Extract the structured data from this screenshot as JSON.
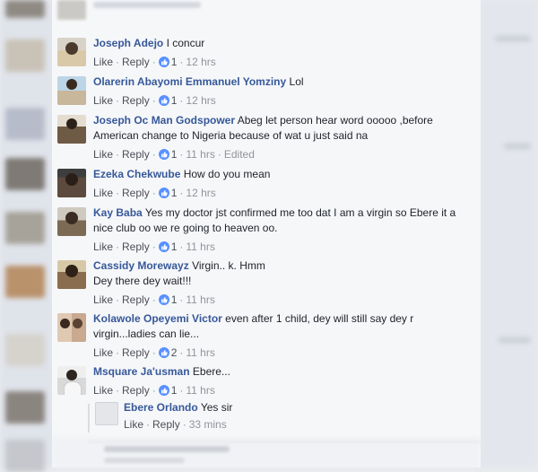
{
  "actions": {
    "like": "Like",
    "reply": "Reply"
  },
  "comments": [
    {
      "name": "Joseph Adejo",
      "text": "I concur",
      "likes": "1",
      "time": "12 hrs",
      "edited": ""
    },
    {
      "name": "Olarerin Abayomi Emmanuel Yomziny",
      "text": "Lol",
      "likes": "1",
      "time": "12 hrs",
      "edited": ""
    },
    {
      "name": "Joseph Oc Man Godspower",
      "text": "Abeg let person hear word ooooo ,before American change to Nigeria because of wat u just said na",
      "likes": "1",
      "time": "11 hrs",
      "edited": "Edited"
    },
    {
      "name": "Ezeka Chekwube",
      "text": "How do you mean",
      "likes": "1",
      "time": "12 hrs",
      "edited": ""
    },
    {
      "name": "Kay Baba",
      "text": "Yes my doctor jst confirmed me too dat I am a virgin so Ebere it a nice club oo we re going to heaven oo.",
      "likes": "1",
      "time": "11 hrs",
      "edited": ""
    },
    {
      "name": "Cassidy Morewayz",
      "text": "Virgin.. k. Hmm",
      "text2": "Dey there dey wait!!!",
      "likes": "1",
      "time": "11 hrs",
      "edited": ""
    },
    {
      "name": "Kolawole Opeyemi Victor",
      "text": "even after 1 child, dey will still say dey r virgin...ladies can lie...",
      "likes": "2",
      "time": "11 hrs",
      "edited": ""
    },
    {
      "name": "Msquare Ja'usman",
      "text": "Ebere...",
      "likes": "1",
      "time": "11 hrs",
      "edited": ""
    }
  ],
  "reply": {
    "name": "Ebere Orlando",
    "text": "Yes sir",
    "time": "33 mins"
  },
  "colors": {
    "link": "#365899",
    "like_badge": "#5890ff",
    "panel": "#f6f7f9"
  }
}
